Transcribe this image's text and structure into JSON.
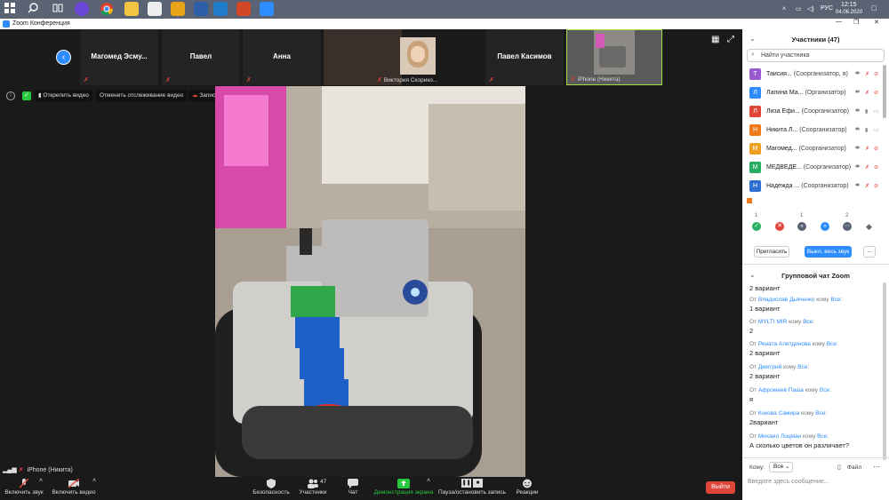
{
  "taskbar": {
    "lang": "РУС",
    "time": "12:15",
    "date": "04.06.2020"
  },
  "window": {
    "title": "Zoom Конференция"
  },
  "strip": {
    "participants": [
      {
        "name": "Магомед  Эсму..."
      },
      {
        "name": "Павел"
      },
      {
        "name": "Анна"
      },
      {
        "name": "Виктория Скорико..."
      },
      {
        "name": "Павел Касимов"
      },
      {
        "name": "iPhone (Никита)"
      }
    ]
  },
  "video_controls": {
    "unpin": "Открепить видео",
    "stop_tracking": "Отменить отслеживание видео",
    "recording": "Запись..."
  },
  "main_video": {
    "name": "iPhone (Никита)"
  },
  "toolbar": {
    "mute": "Включить звук",
    "video": "Включить видео",
    "security": "Безопасность",
    "participants": "Участники",
    "participants_count": "47",
    "chat": "Чат",
    "share": "Демонстрация экрана",
    "record": "Пауза/остановить запись",
    "reactions": "Реакции",
    "leave": "Выйти"
  },
  "panel": {
    "title": "Участники (47)",
    "search_placeholder": "Найти участника",
    "participants": [
      {
        "initial": "Т",
        "name": "Таисия...",
        "role": "(Соорганизатор, я)",
        "color": "#9b59d0"
      },
      {
        "initial": "Л",
        "name": "Лапина Ма...",
        "role": "(Организатор)",
        "color": "#2d8cff"
      },
      {
        "initial": "Л",
        "name": "Лиза Ефи...",
        "role": "(Соорганизатор)",
        "color": "#e0453a"
      },
      {
        "initial": "Н",
        "name": "Никита Л...",
        "role": "(Соорганизатор)",
        "color": "#f07a1a"
      },
      {
        "initial": "М",
        "name": "Магомед...",
        "role": "(Соорганизатор)",
        "color": "#f0a020"
      },
      {
        "initial": "М",
        "name": "МЕДВЕДЕ...",
        "role": "(Соорганизатор)",
        "color": "#27ae60"
      },
      {
        "initial": "Н",
        "name": "Надежда ...",
        "role": "(Соорганизатор)",
        "color": "#2d6fd0"
      }
    ],
    "reaction_counts": [
      "1",
      "",
      "1",
      "",
      "2",
      ""
    ],
    "invite": "Пригласить",
    "mute_all": "Выкл. весь звук",
    "more": "...",
    "chat_title": "Групповой чат Zoom",
    "chat_first": "2 вариант",
    "chat_messages": [
      {
        "from": "Владислав Дьяченко",
        "to": "Все",
        "text": "1 вариант"
      },
      {
        "from": "MYLTI MIR",
        "to": "Все",
        "text": "2"
      },
      {
        "from": "Рената Алетдинова",
        "to": "Все",
        "text": "2 вариант"
      },
      {
        "from": "Дмитрий",
        "to": "Все",
        "text": "2 вариант"
      },
      {
        "from": "Афромеев Паша",
        "to": "Все",
        "text": "я"
      },
      {
        "from": "Кокова Самира",
        "to": "Все",
        "text": "2вариант"
      },
      {
        "from": "Михаил Лоцман",
        "to": "Все",
        "text": "А сколько цветов он различает?"
      }
    ],
    "from_word": "От",
    "to_word": "кому",
    "to_label": "Кому:",
    "to_value": "Все",
    "file_label": "Файл",
    "input_placeholder": "Введите здесь сообщение..."
  },
  "colors": {
    "accent": "#2d8cff",
    "leave": "#e0453a",
    "share": "#27c93f"
  }
}
